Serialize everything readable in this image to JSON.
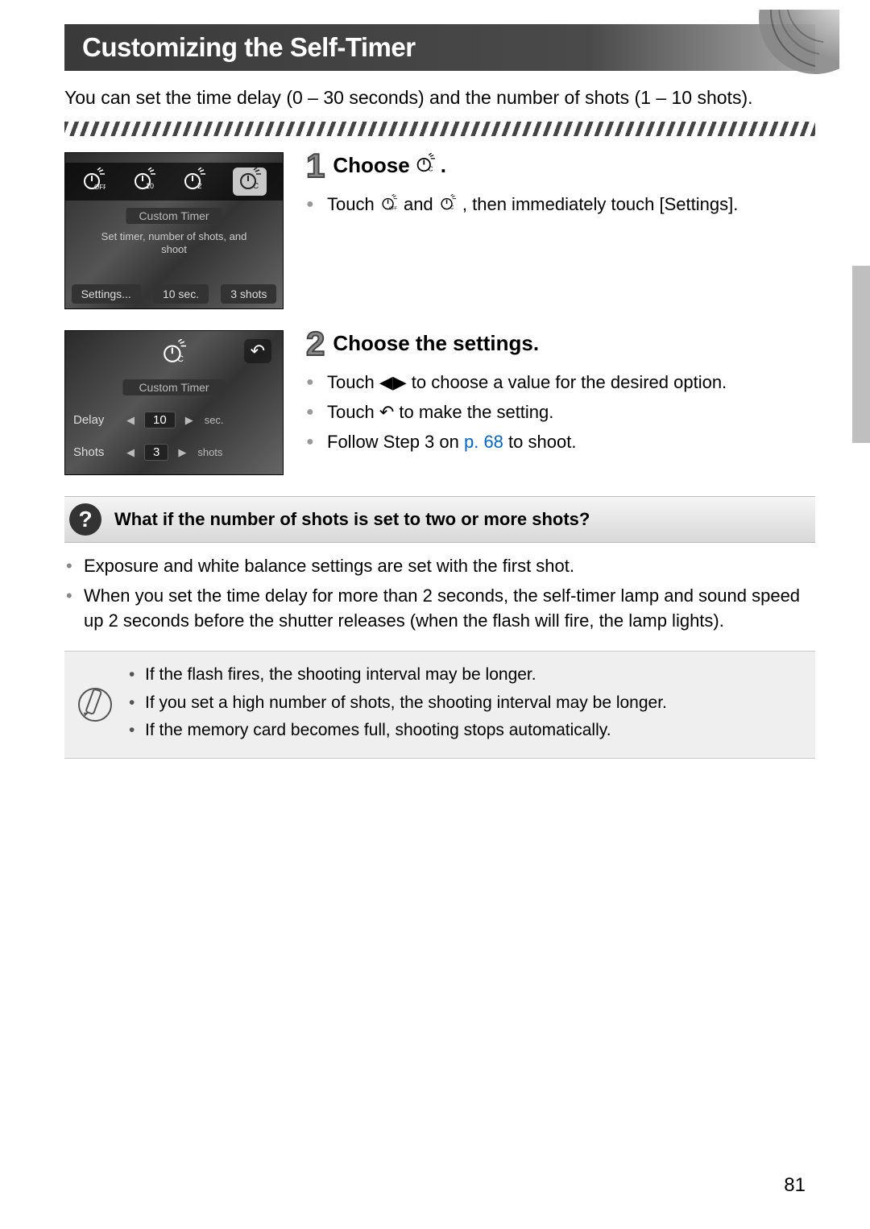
{
  "title": "Customizing the Self-Timer",
  "intro": "You can set the time delay (0 – 30 seconds) and the number of shots (1 – 10 shots).",
  "page_number": "81",
  "screenshot1": {
    "label": "Custom Timer",
    "hint": "Set timer, number of shots, and shoot",
    "settings_btn": "Settings...",
    "sec_label": "10 sec.",
    "shots_label": "3 shots"
  },
  "screenshot2": {
    "label": "Custom Timer",
    "delay_label": "Delay",
    "delay_val": "10",
    "delay_unit": "sec.",
    "shots_label": "Shots",
    "shots_val": "3",
    "shots_unit": "shots"
  },
  "step1": {
    "num": "1",
    "title_pre": "Choose ",
    "title_icon": "timer-custom-icon",
    "title_post": ".",
    "b1_pre": "Touch ",
    "b1_icon1": "timer-off-icon",
    "b1_mid": " and ",
    "b1_icon2": "timer-custom-icon",
    "b1_post": ", then immediately touch [Settings]."
  },
  "step2": {
    "num": "2",
    "title": "Choose the settings.",
    "b1_pre": "Touch ",
    "b1_icon": "left-right-arrows-icon",
    "b1_post": " to choose a value for the desired option.",
    "b2_pre": "Touch ",
    "b2_icon": "return-icon",
    "b2_post": " to make the setting.",
    "b3_pre": "Follow Step 3 on ",
    "b3_link": "p. 68",
    "b3_post": " to shoot."
  },
  "qa": {
    "title": "What if the number of shots is set to two or more shots?",
    "items": [
      "Exposure and white balance settings are set with the first shot.",
      "When you set the time delay for more than 2 seconds, the self-timer lamp and sound speed up 2 seconds before the shutter releases (when the flash will fire, the lamp lights)."
    ]
  },
  "note": {
    "items": [
      "If the flash fires, the shooting interval may be longer.",
      "If you set a high number of shots, the shooting interval may be longer.",
      "If the memory card becomes full, shooting stops automatically."
    ]
  }
}
